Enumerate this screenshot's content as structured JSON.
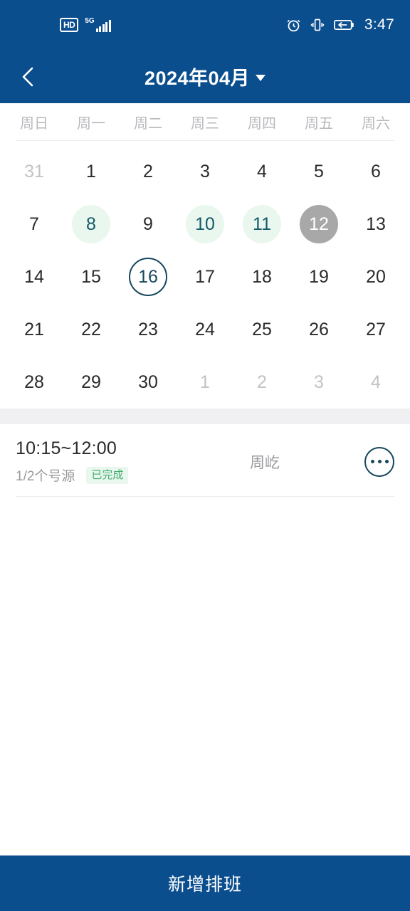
{
  "status_bar": {
    "hd_label": "HD",
    "network_label": "5G",
    "signal_icon": "signal-bars-icon",
    "alarm_icon": "alarm-clock-icon",
    "vibrate_icon": "vibrate-icon",
    "battery_icon": "battery-charging-icon",
    "time": "3:47"
  },
  "header": {
    "back_icon": "chevron-left-icon",
    "title": "2024年04月",
    "caret_icon": "chevron-down-icon"
  },
  "calendar": {
    "weekdays": [
      "周日",
      "周一",
      "周二",
      "周三",
      "周四",
      "周五",
      "周六"
    ],
    "weeks": [
      [
        {
          "label": "31",
          "state": "muted"
        },
        {
          "label": "1",
          "state": "normal"
        },
        {
          "label": "2",
          "state": "normal"
        },
        {
          "label": "3",
          "state": "normal"
        },
        {
          "label": "4",
          "state": "normal"
        },
        {
          "label": "5",
          "state": "normal"
        },
        {
          "label": "6",
          "state": "normal"
        }
      ],
      [
        {
          "label": "7",
          "state": "normal"
        },
        {
          "label": "8",
          "state": "has-slot"
        },
        {
          "label": "9",
          "state": "normal"
        },
        {
          "label": "10",
          "state": "has-slot"
        },
        {
          "label": "11",
          "state": "has-slot"
        },
        {
          "label": "12",
          "state": "disabled-day"
        },
        {
          "label": "13",
          "state": "normal"
        }
      ],
      [
        {
          "label": "14",
          "state": "normal"
        },
        {
          "label": "15",
          "state": "normal"
        },
        {
          "label": "16",
          "state": "selected"
        },
        {
          "label": "17",
          "state": "normal"
        },
        {
          "label": "18",
          "state": "normal"
        },
        {
          "label": "19",
          "state": "normal"
        },
        {
          "label": "20",
          "state": "normal"
        }
      ],
      [
        {
          "label": "21",
          "state": "normal"
        },
        {
          "label": "22",
          "state": "normal"
        },
        {
          "label": "23",
          "state": "normal"
        },
        {
          "label": "24",
          "state": "normal"
        },
        {
          "label": "25",
          "state": "normal"
        },
        {
          "label": "26",
          "state": "normal"
        },
        {
          "label": "27",
          "state": "normal"
        }
      ],
      [
        {
          "label": "28",
          "state": "normal"
        },
        {
          "label": "29",
          "state": "normal"
        },
        {
          "label": "30",
          "state": "normal"
        },
        {
          "label": "1",
          "state": "muted"
        },
        {
          "label": "2",
          "state": "muted"
        },
        {
          "label": "3",
          "state": "muted"
        },
        {
          "label": "4",
          "state": "muted"
        }
      ]
    ]
  },
  "schedule": {
    "items": [
      {
        "time_range": "10:15~12:00",
        "slots": "1/2个号源",
        "status_badge": "已完成",
        "person": "周屹",
        "more_icon": "more-options-icon"
      }
    ]
  },
  "bottom_bar": {
    "add_shift_label": "新增排班"
  },
  "colors": {
    "brand_blue": "#0b4e8e",
    "slot_green_bg": "#e9f7ee",
    "slot_green_text": "#15596b",
    "badge_text": "#3fae6c",
    "selected_outline": "#17475e",
    "disabled_day_bg": "#a8a8a8"
  }
}
